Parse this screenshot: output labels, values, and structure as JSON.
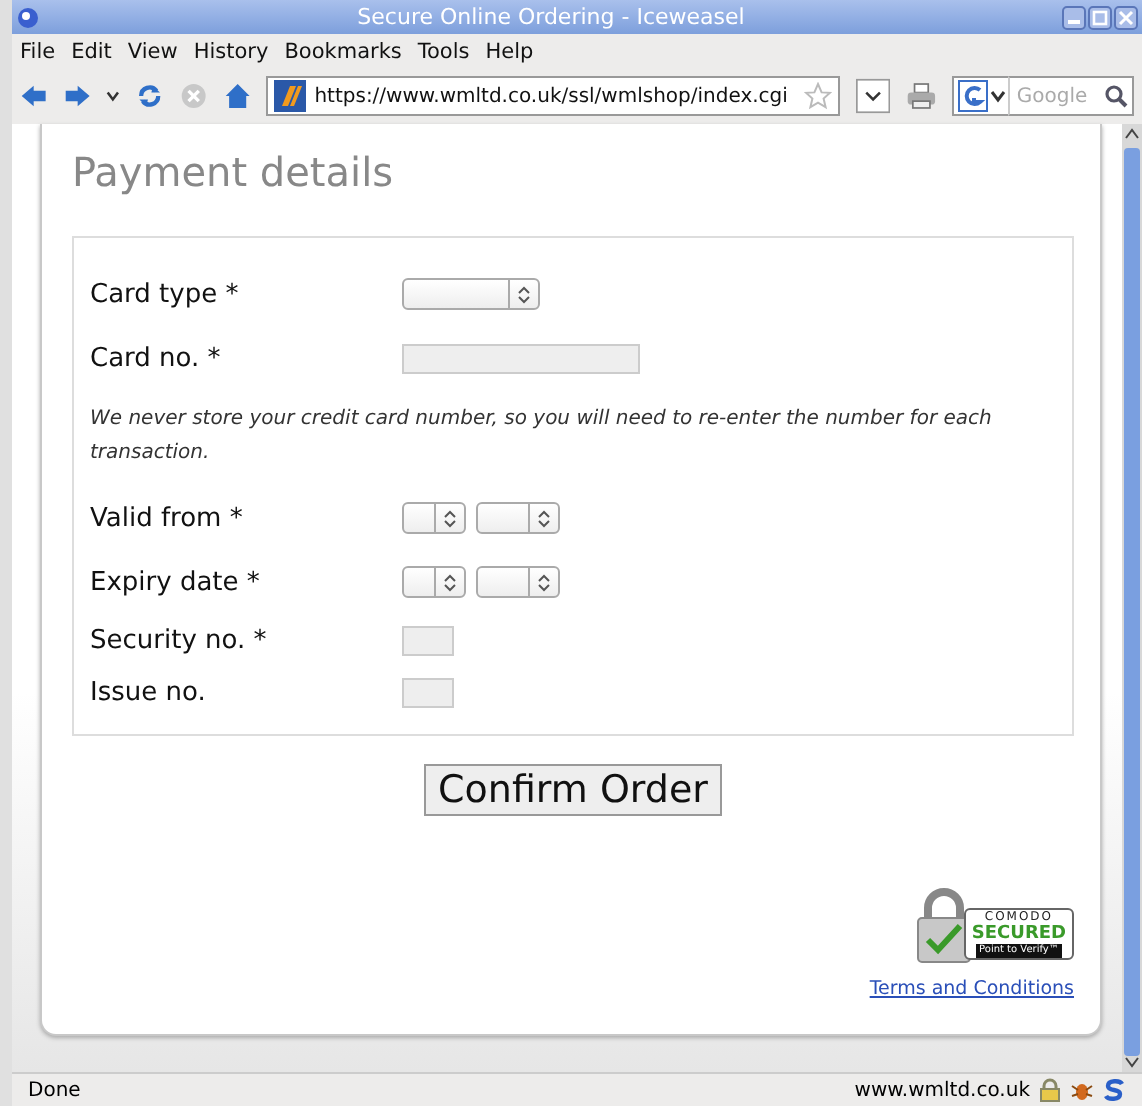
{
  "window": {
    "title": "Secure Online Ordering - Iceweasel"
  },
  "menu": [
    "File",
    "Edit",
    "View",
    "History",
    "Bookmarks",
    "Tools",
    "Help"
  ],
  "toolbar": {
    "url": "https://www.wmltd.co.uk/ssl/wmlshop/index.cgi",
    "search_placeholder": "Google"
  },
  "page": {
    "heading": "Payment details",
    "fields": [
      {
        "label": "Card type *",
        "controls": [
          {
            "kind": "dropdown"
          }
        ]
      },
      {
        "label": "Card no. *",
        "controls": [
          {
            "kind": "textbox"
          }
        ]
      },
      {
        "kind": "note",
        "text": "We never store your credit card number, so you will need to re-enter the number for each transaction."
      },
      {
        "label": "Valid from *",
        "controls": [
          {
            "kind": "short-dropdown"
          },
          {
            "kind": "dropdown-medium"
          }
        ]
      },
      {
        "label": "Expiry date *",
        "controls": [
          {
            "kind": "short-dropdown"
          },
          {
            "kind": "dropdown-medium"
          }
        ]
      },
      {
        "label": "Security no. *",
        "controls": [
          {
            "kind": "short-textbox"
          }
        ]
      },
      {
        "label": "Issue no.",
        "controls": [
          {
            "kind": "short-textbox"
          }
        ]
      }
    ],
    "confirm_button": "Confirm Order",
    "seal": {
      "brand": "COMODO",
      "status": "SECURED",
      "hint": "Point to Verify™"
    },
    "terms_link": "Terms and Conditions"
  },
  "status_bar": {
    "text": "Done",
    "site": "www.wmltd.co.uk"
  }
}
